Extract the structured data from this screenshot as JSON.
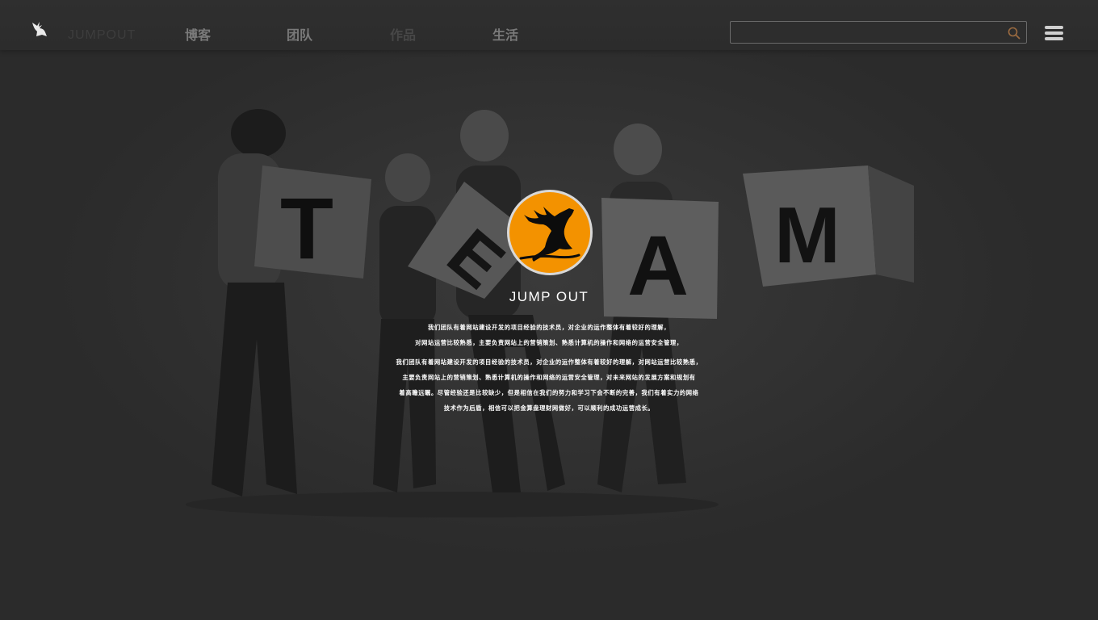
{
  "header": {
    "logo_text": "JUMPOUT",
    "nav": [
      {
        "label": "博客",
        "color": "#7a7a7a"
      },
      {
        "label": "团队",
        "color": "#7a7a7a"
      },
      {
        "label": "作品",
        "color": "#474747"
      },
      {
        "label": "生活",
        "color": "#7a7a7a"
      }
    ],
    "search": {
      "value": "",
      "placeholder": ""
    }
  },
  "hero": {
    "brand": "JUMP OUT",
    "intro_lines": [
      "我们团队有着网站建设开发的项目经验的技术员，对企业的运作整体有着较好的理解，",
      "对网站运营比较熟悉，主要负责网站上的营销策划、熟悉计算机的操作和网络的运营安全管理，"
    ],
    "detail_lines": [
      "我们团队有着网站建设开发的项目经验的技术员，对企业的运作整体有着较好的理解，对网站运营比较熟悉，",
      "主要负责网站上的营销策划、熟悉计算机的操作和网络的运营安全管理，对未来网站的发展方案和规划有",
      "着高瞻远瞩。尽管经验还是比较缺少，但是相信在我们的努力和学习下会不断的完善，我们有着实力的网络",
      "技术作为后盾，相信可以把金算盘理财网做好，可以顺利的成功运营成长。"
    ],
    "photo_letters": [
      "T",
      "E",
      "A",
      "M"
    ]
  },
  "colors": {
    "page_bg": "#2b2b2b",
    "accent_orange": "#f39200",
    "nav_text": "#7a7a7a"
  },
  "icons": {
    "logo": "deer-logo-icon",
    "search": "search-icon",
    "menu": "hamburger-menu-icon"
  }
}
